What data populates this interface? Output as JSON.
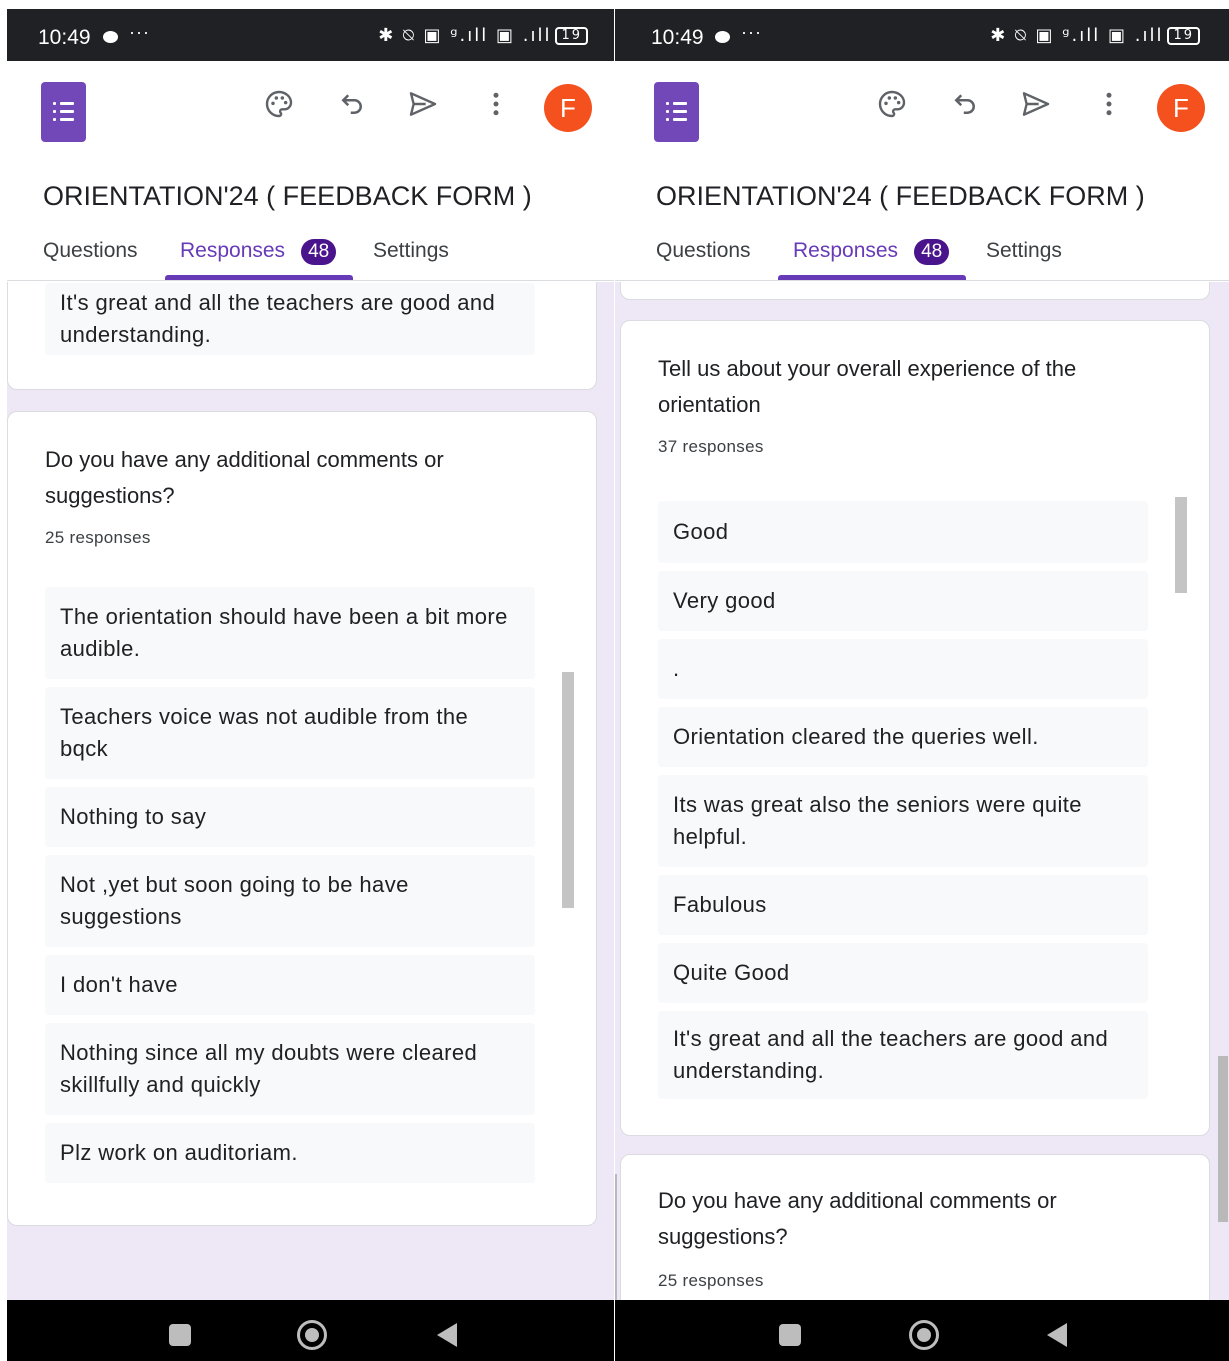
{
  "status": {
    "time": "10:49",
    "dots": "···",
    "sys_icons": "✱ ⍉ ▣ ᵍ.ıll ▣ .ıll",
    "battery": "19"
  },
  "app": {
    "form_title": "ORIENTATION'24 ( FEEDBACK FORM )",
    "tabs": {
      "questions": "Questions",
      "responses": "Responses",
      "responses_badge": "48",
      "settings": "Settings"
    },
    "avatar_letter": "F"
  },
  "left": {
    "top_response": "It's great and all the teachers are good and understanding.",
    "question": "Do you have any additional comments or suggestions?",
    "count": "25 responses",
    "responses": [
      "The orientation should have been a bit more audible.",
      "Teachers voice was not audible from the bqck",
      "Nothing to say",
      "Not ,yet but soon going to be have suggestions",
      "I don't have",
      "Nothing since all my doubts were cleared skillfully and quickly",
      "Plz work on auditoriam."
    ]
  },
  "right": {
    "question": "Tell us about your overall experience of the orientation",
    "count": "37 responses",
    "responses": [
      "Good",
      "Very good",
      ".",
      "Orientation cleared the queries well.",
      "Its was great also the seniors were quite helpful.",
      "Fabulous",
      "Quite Good",
      "It's great and all the teachers are good and understanding."
    ],
    "next_question": "Do you have any additional comments or suggestions?",
    "next_count": "25 responses"
  },
  "colors": {
    "accent": "#673ab7",
    "badge": "#4a148c",
    "avatar": "#f4511e",
    "forms_logo": "#7248b9",
    "background": "#ede7f6"
  },
  "icons": [
    "palette-icon",
    "undo-icon",
    "send-icon",
    "more-vert-icon",
    "forms-logo-icon",
    "recents-icon",
    "home-icon",
    "back-icon"
  ]
}
